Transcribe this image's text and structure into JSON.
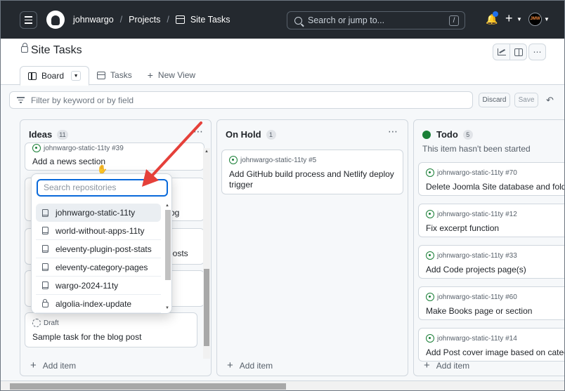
{
  "nav": {
    "user": "johnwargo",
    "projects": "Projects",
    "project": "Site Tasks",
    "search_placeholder": "Search or jump to...",
    "search_shortcut": "/",
    "avatar_text": "JMW"
  },
  "project": {
    "title": "Site Tasks",
    "tabs": [
      {
        "label": "Board"
      },
      {
        "label": "Tasks"
      },
      {
        "label": "New View"
      }
    ]
  },
  "filter": {
    "placeholder": "Filter by keyword or by field",
    "discard": "Discard",
    "save": "Save"
  },
  "columns": {
    "ideas": {
      "title": "Ideas",
      "count": "11",
      "cards": [
        {
          "repo": "johnwargo-static-11ty #39",
          "title": "Add a news section"
        },
        {
          "title_tail": "og"
        },
        {
          "title_tail": "posts"
        },
        {
          "repo": "Draft",
          "title": "Sample task for the blog post"
        }
      ],
      "add": "Add item"
    },
    "hold": {
      "title": "On Hold",
      "count": "1",
      "cards": [
        {
          "repo": "johnwargo-static-11ty #5",
          "title": "Add GitHub build process and Netlify deploy trigger"
        }
      ],
      "add": "Add item"
    },
    "todo": {
      "title": "Todo",
      "count": "5",
      "description": "This item hasn't been started",
      "color": "#1a7f37",
      "cards": [
        {
          "repo": "johnwargo-static-11ty #70",
          "title": "Delete Joomla Site database and folder"
        },
        {
          "repo": "johnwargo-static-11ty #12",
          "title": "Fix excerpt function"
        },
        {
          "repo": "johnwargo-static-11ty #33",
          "title": "Add Code projects page(s)"
        },
        {
          "repo": "johnwargo-static-11ty #60",
          "title": "Make Books page or section"
        },
        {
          "repo": "johnwargo-static-11ty #14",
          "title": "Add Post cover image based on category"
        }
      ],
      "add": "Add item"
    }
  },
  "repo_picker": {
    "placeholder": "Search repositories",
    "repos": [
      {
        "name": "johnwargo-static-11ty",
        "icon": "repo-icon"
      },
      {
        "name": "world-without-apps-11ty",
        "icon": "repo-icon"
      },
      {
        "name": "eleventy-plugin-post-stats",
        "icon": "repo-icon"
      },
      {
        "name": "eleventy-category-pages",
        "icon": "repo-icon"
      },
      {
        "name": "wargo-2024-11ty",
        "icon": "repo-icon"
      },
      {
        "name": "algolia-index-update",
        "icon": "lock-icon"
      }
    ]
  },
  "colors": {
    "accent": "#0969da",
    "arrow": "#e5403a",
    "nav_bg": "#24292f"
  }
}
